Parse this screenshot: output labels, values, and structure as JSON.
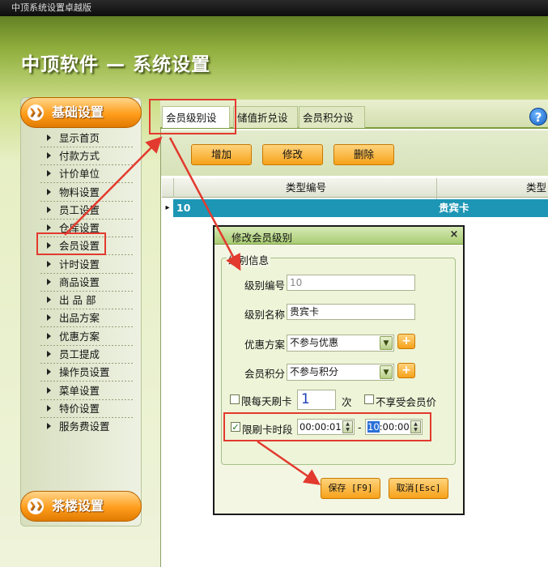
{
  "window": {
    "title": "中顶系统设置卓越版"
  },
  "header": {
    "title": "中顶软件 — 系统设置"
  },
  "sidebar": {
    "basic_button": "基础设置",
    "teahouse_button": "茶楼设置",
    "items": [
      {
        "label": "显示首页"
      },
      {
        "label": "付款方式"
      },
      {
        "label": "计价单位"
      },
      {
        "label": "物料设置"
      },
      {
        "label": "员工设置"
      },
      {
        "label": "仓库设置"
      },
      {
        "label": "会员设置"
      },
      {
        "label": "计时设置"
      },
      {
        "label": "商品设置"
      },
      {
        "label": "出 品 部"
      },
      {
        "label": "出品方案"
      },
      {
        "label": "优惠方案"
      },
      {
        "label": "员工提成"
      },
      {
        "label": "操作员设置"
      },
      {
        "label": "菜单设置"
      },
      {
        "label": "特价设置"
      },
      {
        "label": "服务费设置"
      }
    ]
  },
  "tabs": [
    {
      "label": "会员级别设置"
    },
    {
      "label": "储值折兑设置"
    },
    {
      "label": "会员积分设置"
    }
  ],
  "help": {
    "icon": "help-icon",
    "glyph": "?"
  },
  "toolbar": {
    "add": "增加",
    "edit": "修改",
    "delete": "删除"
  },
  "grid": {
    "columns": [
      "类型编号",
      "类型名"
    ],
    "row_marker": "▸",
    "rows": [
      {
        "code": "10",
        "name": "贵宾卡"
      }
    ]
  },
  "dialog": {
    "title": "修改会员级别",
    "close": "×",
    "group_title": "级别信息",
    "level_code_label": "级别编号",
    "level_code_value": "10",
    "level_name_label": "级别名称",
    "level_name_value": "贵宾卡",
    "discount_label": "优惠方案",
    "discount_value": "不参与优惠",
    "points_label": "会员积分",
    "points_value": "不参与积分",
    "plus": "+",
    "daily_limit_label": "限每天刷卡",
    "daily_limit_value": "1",
    "daily_limit_unit": "次",
    "no_member_price_label": "不享受会员价",
    "time_limit_label": "限刷卡时段",
    "time_start": "00:00:01",
    "time_end_hour": "10",
    "time_end_rest": ":00:00",
    "time_sep": "-",
    "save": "保存 [F9]",
    "cancel": "取消[Esc]"
  },
  "colors": {
    "accent_orange": "#f6a21a",
    "selected_row": "#1d96b5",
    "annotation_red": "#e23a2e"
  }
}
